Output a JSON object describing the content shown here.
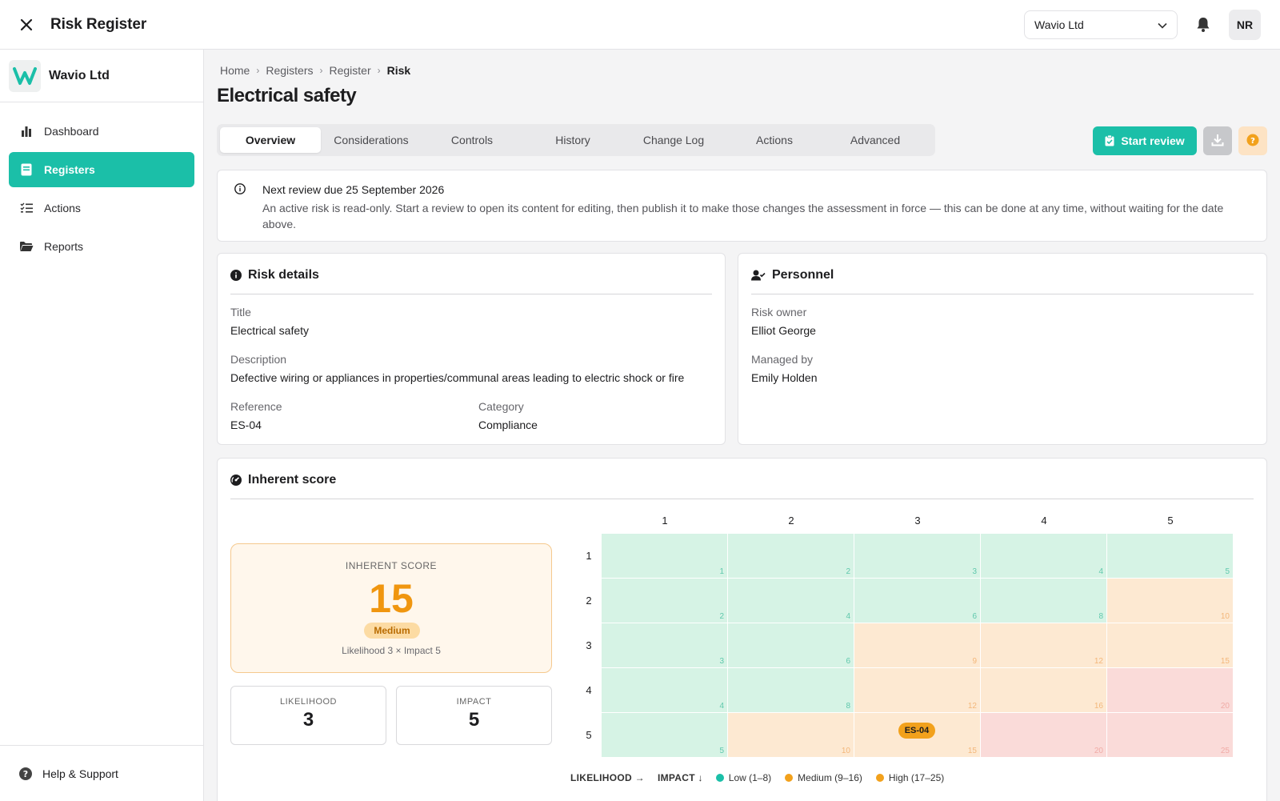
{
  "header": {
    "title": "Risk Register",
    "org_select": "Wavio Ltd",
    "avatar": "NR"
  },
  "sidebar": {
    "org_name": "Wavio Ltd",
    "items": [
      {
        "label": "Dashboard",
        "icon": "bar-chart-icon",
        "active": false
      },
      {
        "label": "Registers",
        "icon": "register-book-icon",
        "active": true
      },
      {
        "label": "Actions",
        "icon": "checklist-icon",
        "active": false
      },
      {
        "label": "Reports",
        "icon": "folder-icon",
        "active": false
      }
    ],
    "help_label": "Help & Support"
  },
  "breadcrumb": [
    "Home",
    "Registers",
    "Register",
    "Risk"
  ],
  "page_title": "Electrical safety",
  "tabs": [
    "Overview",
    "Considerations",
    "Controls",
    "History",
    "Change Log",
    "Actions",
    "Advanced"
  ],
  "active_tab": "Overview",
  "actions": {
    "start_review": "Start review"
  },
  "notice": {
    "title": "Next review due 25 September 2026",
    "body": "An active risk is read-only. Start a review to open its content for editing, then publish it to make those changes the assessment in force — this can be done at any time, without waiting for the date above."
  },
  "risk_details": {
    "heading": "Risk details",
    "title_label": "Title",
    "title_value": "Electrical safety",
    "description_label": "Description",
    "description_value": "Defective wiring or appliances in properties/communal areas leading to electric shock or fire",
    "reference_label": "Reference",
    "reference_value": "ES-04",
    "category_label": "Category",
    "category_value": "Compliance"
  },
  "personnel": {
    "heading": "Personnel",
    "owner_label": "Risk owner",
    "owner_value": "Elliot George",
    "managed_label": "Managed by",
    "managed_value": "Emily Holden"
  },
  "inherent": {
    "heading": "Inherent score",
    "score_label": "INHERENT SCORE",
    "score": "15",
    "level": "Medium",
    "formula": "Likelihood 3 × Impact 5",
    "likelihood_label": "LIKELIHOOD",
    "likelihood": "3",
    "impact_label": "IMPACT",
    "impact": "5"
  },
  "matrix": {
    "columns": [
      "1",
      "2",
      "3",
      "4",
      "5"
    ],
    "rows": [
      "1",
      "2",
      "3",
      "4",
      "5"
    ],
    "marker": {
      "label": "ES-04",
      "likelihood": 3,
      "impact": 5
    },
    "colors": {
      "low_bg": "#d6f3e5",
      "low_text": "#5fc8ac",
      "medium_bg": "#fde9d2",
      "medium_text": "#f3b77a",
      "high_bg": "#fadbd9",
      "high_text": "#f0aba6"
    }
  },
  "legend": {
    "likelihood_axis": "LIKELIHOOD →",
    "impact_axis": "IMPACT ↓",
    "items": [
      {
        "label": "Low (1–8)",
        "color": "#1bbfa8"
      },
      {
        "label": "Medium (9–16)",
        "color": "#f2a11c"
      },
      {
        "label": "High (17–25)",
        "color": "#f2a11c"
      }
    ]
  }
}
